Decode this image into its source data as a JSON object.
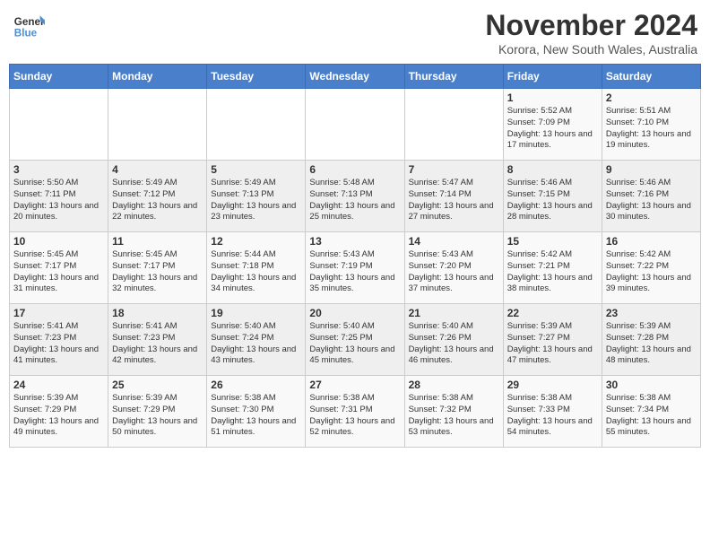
{
  "header": {
    "logo_general": "General",
    "logo_blue": "Blue",
    "month_title": "November 2024",
    "location": "Korora, New South Wales, Australia"
  },
  "weekdays": [
    "Sunday",
    "Monday",
    "Tuesday",
    "Wednesday",
    "Thursday",
    "Friday",
    "Saturday"
  ],
  "weeks": [
    [
      {
        "day": "",
        "sunrise": "",
        "sunset": "",
        "daylight": ""
      },
      {
        "day": "",
        "sunrise": "",
        "sunset": "",
        "daylight": ""
      },
      {
        "day": "",
        "sunrise": "",
        "sunset": "",
        "daylight": ""
      },
      {
        "day": "",
        "sunrise": "",
        "sunset": "",
        "daylight": ""
      },
      {
        "day": "",
        "sunrise": "",
        "sunset": "",
        "daylight": ""
      },
      {
        "day": "1",
        "sunrise": "Sunrise: 5:52 AM",
        "sunset": "Sunset: 7:09 PM",
        "daylight": "Daylight: 13 hours and 17 minutes."
      },
      {
        "day": "2",
        "sunrise": "Sunrise: 5:51 AM",
        "sunset": "Sunset: 7:10 PM",
        "daylight": "Daylight: 13 hours and 19 minutes."
      }
    ],
    [
      {
        "day": "3",
        "sunrise": "Sunrise: 5:50 AM",
        "sunset": "Sunset: 7:11 PM",
        "daylight": "Daylight: 13 hours and 20 minutes."
      },
      {
        "day": "4",
        "sunrise": "Sunrise: 5:49 AM",
        "sunset": "Sunset: 7:12 PM",
        "daylight": "Daylight: 13 hours and 22 minutes."
      },
      {
        "day": "5",
        "sunrise": "Sunrise: 5:49 AM",
        "sunset": "Sunset: 7:13 PM",
        "daylight": "Daylight: 13 hours and 23 minutes."
      },
      {
        "day": "6",
        "sunrise": "Sunrise: 5:48 AM",
        "sunset": "Sunset: 7:13 PM",
        "daylight": "Daylight: 13 hours and 25 minutes."
      },
      {
        "day": "7",
        "sunrise": "Sunrise: 5:47 AM",
        "sunset": "Sunset: 7:14 PM",
        "daylight": "Daylight: 13 hours and 27 minutes."
      },
      {
        "day": "8",
        "sunrise": "Sunrise: 5:46 AM",
        "sunset": "Sunset: 7:15 PM",
        "daylight": "Daylight: 13 hours and 28 minutes."
      },
      {
        "day": "9",
        "sunrise": "Sunrise: 5:46 AM",
        "sunset": "Sunset: 7:16 PM",
        "daylight": "Daylight: 13 hours and 30 minutes."
      }
    ],
    [
      {
        "day": "10",
        "sunrise": "Sunrise: 5:45 AM",
        "sunset": "Sunset: 7:17 PM",
        "daylight": "Daylight: 13 hours and 31 minutes."
      },
      {
        "day": "11",
        "sunrise": "Sunrise: 5:45 AM",
        "sunset": "Sunset: 7:17 PM",
        "daylight": "Daylight: 13 hours and 32 minutes."
      },
      {
        "day": "12",
        "sunrise": "Sunrise: 5:44 AM",
        "sunset": "Sunset: 7:18 PM",
        "daylight": "Daylight: 13 hours and 34 minutes."
      },
      {
        "day": "13",
        "sunrise": "Sunrise: 5:43 AM",
        "sunset": "Sunset: 7:19 PM",
        "daylight": "Daylight: 13 hours and 35 minutes."
      },
      {
        "day": "14",
        "sunrise": "Sunrise: 5:43 AM",
        "sunset": "Sunset: 7:20 PM",
        "daylight": "Daylight: 13 hours and 37 minutes."
      },
      {
        "day": "15",
        "sunrise": "Sunrise: 5:42 AM",
        "sunset": "Sunset: 7:21 PM",
        "daylight": "Daylight: 13 hours and 38 minutes."
      },
      {
        "day": "16",
        "sunrise": "Sunrise: 5:42 AM",
        "sunset": "Sunset: 7:22 PM",
        "daylight": "Daylight: 13 hours and 39 minutes."
      }
    ],
    [
      {
        "day": "17",
        "sunrise": "Sunrise: 5:41 AM",
        "sunset": "Sunset: 7:23 PM",
        "daylight": "Daylight: 13 hours and 41 minutes."
      },
      {
        "day": "18",
        "sunrise": "Sunrise: 5:41 AM",
        "sunset": "Sunset: 7:23 PM",
        "daylight": "Daylight: 13 hours and 42 minutes."
      },
      {
        "day": "19",
        "sunrise": "Sunrise: 5:40 AM",
        "sunset": "Sunset: 7:24 PM",
        "daylight": "Daylight: 13 hours and 43 minutes."
      },
      {
        "day": "20",
        "sunrise": "Sunrise: 5:40 AM",
        "sunset": "Sunset: 7:25 PM",
        "daylight": "Daylight: 13 hours and 45 minutes."
      },
      {
        "day": "21",
        "sunrise": "Sunrise: 5:40 AM",
        "sunset": "Sunset: 7:26 PM",
        "daylight": "Daylight: 13 hours and 46 minutes."
      },
      {
        "day": "22",
        "sunrise": "Sunrise: 5:39 AM",
        "sunset": "Sunset: 7:27 PM",
        "daylight": "Daylight: 13 hours and 47 minutes."
      },
      {
        "day": "23",
        "sunrise": "Sunrise: 5:39 AM",
        "sunset": "Sunset: 7:28 PM",
        "daylight": "Daylight: 13 hours and 48 minutes."
      }
    ],
    [
      {
        "day": "24",
        "sunrise": "Sunrise: 5:39 AM",
        "sunset": "Sunset: 7:29 PM",
        "daylight": "Daylight: 13 hours and 49 minutes."
      },
      {
        "day": "25",
        "sunrise": "Sunrise: 5:39 AM",
        "sunset": "Sunset: 7:29 PM",
        "daylight": "Daylight: 13 hours and 50 minutes."
      },
      {
        "day": "26",
        "sunrise": "Sunrise: 5:38 AM",
        "sunset": "Sunset: 7:30 PM",
        "daylight": "Daylight: 13 hours and 51 minutes."
      },
      {
        "day": "27",
        "sunrise": "Sunrise: 5:38 AM",
        "sunset": "Sunset: 7:31 PM",
        "daylight": "Daylight: 13 hours and 52 minutes."
      },
      {
        "day": "28",
        "sunrise": "Sunrise: 5:38 AM",
        "sunset": "Sunset: 7:32 PM",
        "daylight": "Daylight: 13 hours and 53 minutes."
      },
      {
        "day": "29",
        "sunrise": "Sunrise: 5:38 AM",
        "sunset": "Sunset: 7:33 PM",
        "daylight": "Daylight: 13 hours and 54 minutes."
      },
      {
        "day": "30",
        "sunrise": "Sunrise: 5:38 AM",
        "sunset": "Sunset: 7:34 PM",
        "daylight": "Daylight: 13 hours and 55 minutes."
      }
    ]
  ]
}
